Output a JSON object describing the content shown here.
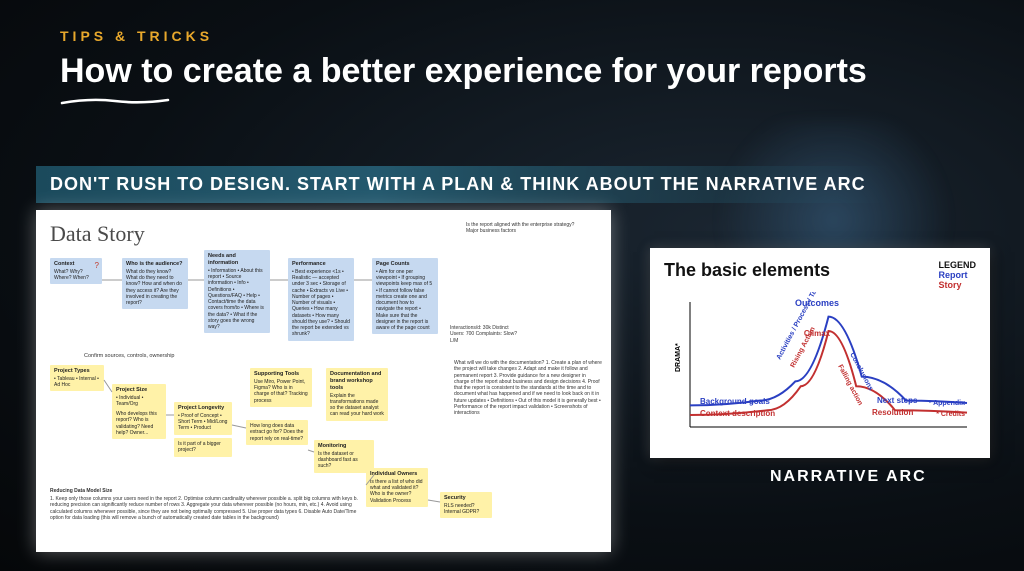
{
  "eyebrow": "TIPS & TRICKS",
  "title": "How to create a better experience for your reports",
  "subhead": "DON'T RUSH TO DESIGN. START WITH A PLAN & THINK ABOUT THE NARRATIVE ARC",
  "data_story": {
    "title": "Data Story",
    "top_right_note": "Is the report aligned with the enterprise strategy?\nMajor business factors",
    "blue": {
      "context": {
        "title": "Context",
        "body": "What?\nWhy?\nWhere?\nWhen?"
      },
      "audience": {
        "title": "Who is the audience?",
        "body": "What do they know?\nWhat do they need to know?\nHow and when do they access it?\nAre they involved in creating the report?"
      },
      "needs": {
        "title": "Needs and information",
        "body": "• Information\n• About this report\n• Source information\n• Info\n• Definitions\n• Questions/FAQ\n• Help\n• Contact/time the data covers from/to\n• Where is the data?\n• What if the story goes the wrong way?"
      },
      "perf": {
        "title": "Performance",
        "body": "• Best experience <1s\n• Realistic — accepted under 3 sec\n• Storage of cache\n• Extracts vs Live\n• Number of pages\n• Number of visuals\n• Queries\n• How many datasets\n• How many should they use?\n• Should the report be extended vs shrunk?"
      },
      "counts": {
        "title": "Page Counts",
        "body": "• Aim for one per viewpoint\n• If grouping viewpoints keep max of 5\n• If cannot follow false metrics create one and document how to navigate the report\n• Make sure that the designer in the report is aware of the page count"
      },
      "metrics": {
        "body": "Interactions/d: 30k\nDistinct Users: 700\nComplaints: Slow? L/M"
      }
    },
    "confirm_row": "Confirm sources, controls, ownership",
    "yellow": {
      "types": {
        "title": "Project Types",
        "body": "• Tableau\n• Internal\n• Ad Hoc"
      },
      "size": {
        "title": "Project Size",
        "body": "• Individual\n• Team/Org"
      },
      "who": {
        "title": "",
        "body": "Who develops this report?\nWho is validating?\nNeed help?\nOwner..."
      },
      "longevity": {
        "title": "Project Longevity",
        "body": "• Proof of Concept\n• Short Term\n• Mid/Long Term\n• Product"
      },
      "bigger": {
        "title": "",
        "body": "Is it part of a bigger project?"
      },
      "supporting": {
        "title": "Supporting Tools",
        "body": "Use Miro, Power Point, Figma?\nWho is in charge of that?\nTracking process"
      },
      "docs": {
        "title": "Documentation and brand workshop tools",
        "body": "Explain the transformations made so the dataset analyst can read your hard work"
      },
      "freq": {
        "title": "",
        "body": "How long does data extract go for?\nDoes the report rely on real-time?"
      },
      "mon": {
        "title": "Monitoring",
        "body": "Is the dataset or dashboard fast as such?"
      },
      "owners": {
        "title": "Individual Owners",
        "body": "Is there a list of who did what and validated it?\nWho is the owner?\nValidation Process"
      },
      "security": {
        "title": "Security",
        "body": "RLS needed?\nInternal GDPR?"
      }
    },
    "sidebar_note": "What will we do with the documentation?\n1. Create a plan of where the project will take changes\n2. Adapt and make it follow and permanent report\n3. Provide guidance for a new designer in charge of the report about business and design decisions\n4. Proof that the report is consistent to the standards at the time and to document what has happened and if we need to look back on it in future updates\n• Definitions\n• Out of this model it is generally best\n• Performance of the report impact validation\n• Screenshots of interactions",
    "footer_title": "Reducing Data Model Size",
    "footer_list": "1. Keep only those columns your users need in the report\n2. Optimise column cardinality wherever possible\n  a. split big columns with keys\n  b. reducing precision can significantly reduce number of rows\n3. Aggregate your data wherever possible (no hours, min, etc.)\n4. Avoid using calculated columns whenever possible, since they are not being optimally compressed\n5. Use proper data types\n6. Disable Auto Date/Time option for data loading (this will remove a bunch of automatically created date tables in the background)"
  },
  "arc": {
    "title": "The basic elements",
    "caption": "NARRATIVE ARC",
    "legend": {
      "head": "LEGEND",
      "report": "Report",
      "story": "Story"
    },
    "y_axis": "DRAMA*",
    "labels": {
      "outcomes": "Outcomes",
      "climax": "Climax",
      "activities": "Activities / Process / Targets",
      "rising": "Rising Action",
      "bg_goals": "Background goals",
      "context": "Context description",
      "conclusions": "Conclusions",
      "falling": "Falling action",
      "next": "Next steps",
      "resolution": "Resolution",
      "appendix": "* Appendix",
      "credits": "* Credits"
    }
  },
  "chart_data": {
    "type": "line",
    "title": "The basic elements",
    "ylabel": "DRAMA*",
    "xlim": [
      0,
      100
    ],
    "ylim": [
      0,
      100
    ],
    "series": [
      {
        "name": "Report",
        "color": "#2a3fc2",
        "points": [
          {
            "x": 0,
            "y": 18,
            "label": "Background goals"
          },
          {
            "x": 25,
            "y": 22
          },
          {
            "x": 38,
            "y": 38,
            "label": "Activities / Process / Targets"
          },
          {
            "x": 50,
            "y": 92,
            "label": "Outcomes"
          },
          {
            "x": 62,
            "y": 42,
            "label": "Conclusions"
          },
          {
            "x": 78,
            "y": 22,
            "label": "Next steps"
          },
          {
            "x": 100,
            "y": 20,
            "label": "* Appendix"
          }
        ]
      },
      {
        "name": "Story",
        "color": "#c23030",
        "points": [
          {
            "x": 0,
            "y": 10,
            "label": "Context description"
          },
          {
            "x": 28,
            "y": 14
          },
          {
            "x": 40,
            "y": 34,
            "label": "Rising Action"
          },
          {
            "x": 50,
            "y": 80,
            "label": "Climax"
          },
          {
            "x": 60,
            "y": 34,
            "label": "Falling action"
          },
          {
            "x": 74,
            "y": 14,
            "label": "Resolution"
          },
          {
            "x": 100,
            "y": 12,
            "label": "* Credits"
          }
        ]
      }
    ]
  }
}
